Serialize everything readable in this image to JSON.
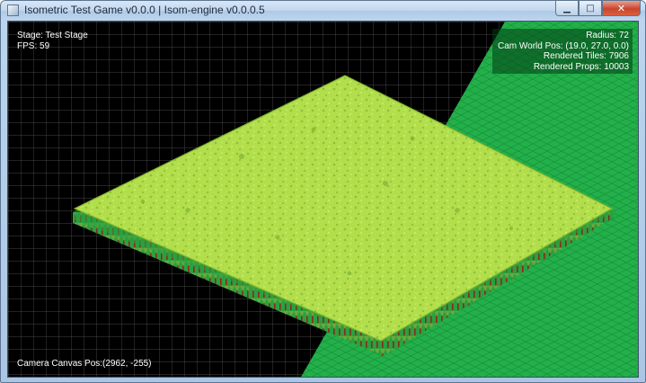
{
  "window": {
    "title": "Isometric Test Game v0.0.0 | Isom-engine v0.0.0.5",
    "controls": {
      "minimize": "▁",
      "maximize": "□",
      "close": "✕"
    }
  },
  "hud": {
    "stage": "Stage: Test Stage",
    "fps": "FPS: 59",
    "radius": "Radius: 72",
    "cam_world_pos": "Cam World Pos: (19.0, 27.0, 0.0)",
    "rendered_tiles": "Rendered Tiles: 7906",
    "rendered_props": "Rendered Props: 10003",
    "camera_canvas_pos": "Camera Canvas Pos:(2962, -255)"
  },
  "colors": {
    "background": "#000000",
    "grid_line": "#5a5a5a",
    "ground_tile": "#22b04a",
    "grass_top": "#b4e04e",
    "grass_dark": "#78b428",
    "tree_trunk": "#8a2a1a"
  }
}
